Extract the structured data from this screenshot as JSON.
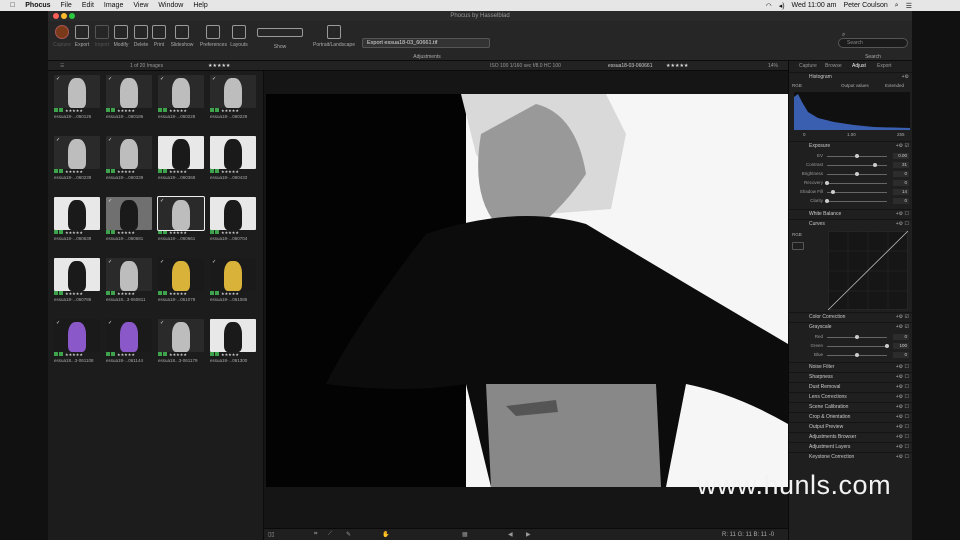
{
  "menubar": {
    "app_name": "Phocus",
    "items": [
      "File",
      "Edit",
      "Image",
      "View",
      "Window",
      "Help"
    ],
    "clock": "Wed 11:00 am",
    "user": "Peter Coulson"
  },
  "window_title": "Phocus by Hasselblad",
  "toolbar": {
    "buttons": [
      {
        "label": "Capture",
        "dim": true
      },
      {
        "label": "Export",
        "dim": false
      },
      {
        "label": "Import",
        "dim": true
      },
      {
        "label": "Modify",
        "dim": false
      },
      {
        "label": "Delete",
        "dim": false
      },
      {
        "label": "Print",
        "dim": false
      },
      {
        "label": "Slideshow",
        "dim": false
      },
      {
        "label": "Preferences",
        "dim": false
      },
      {
        "label": "Layouts",
        "dim": false
      }
    ],
    "show_label": "Show",
    "portrait_label": "Portrait/Landscape",
    "export_select": "Export essua18-03_60661.tif",
    "adjustments_label": "Adjustments",
    "search_placeholder": "Search",
    "search_label": "Search"
  },
  "infobar": {
    "image_count": "1 of 20 Images",
    "exif": "ISO 100   1/160 sec   f/8.0   HC 100",
    "filename": "essua18-03-060661",
    "zoom": "14%"
  },
  "thumbnails": [
    {
      "caption": "essua18-...060126",
      "tone": "dark"
    },
    {
      "caption": "essua18-...060186",
      "tone": "dark"
    },
    {
      "caption": "essua18-...060228",
      "tone": "dark"
    },
    {
      "caption": "essua18-...060229",
      "tone": "dark"
    },
    {
      "caption": "essua18-...060239",
      "tone": "dark"
    },
    {
      "caption": "essua18-...060339",
      "tone": "dark"
    },
    {
      "caption": "essua18-...060368",
      "tone": "light"
    },
    {
      "caption": "essua18-...060433",
      "tone": "light"
    },
    {
      "caption": "essua18-...060639",
      "tone": "light"
    },
    {
      "caption": "essua18-...060681",
      "tone": "grey"
    },
    {
      "caption": "essua18-...060661",
      "tone": "dark",
      "selected": true
    },
    {
      "caption": "essua18-...060704",
      "tone": "light"
    },
    {
      "caption": "essua18-...060786",
      "tone": "light"
    },
    {
      "caption": "essua18...3-060811",
      "tone": "dark"
    },
    {
      "caption": "essua18-...061078",
      "tone": "yellow"
    },
    {
      "caption": "essua18-...061085",
      "tone": "yellow"
    },
    {
      "caption": "essua18...3-061108",
      "tone": "purple"
    },
    {
      "caption": "essua18-...061144",
      "tone": "purple"
    },
    {
      "caption": "essua18...3-061179",
      "tone": "dark"
    },
    {
      "caption": "essua18-...061300",
      "tone": "light"
    }
  ],
  "thumb_stars": "★★★★★",
  "tools": {
    "tabs": [
      "Capture",
      "Browse",
      "Adjust",
      "Export"
    ],
    "active_tab": "Adjust",
    "histogram": {
      "title": "Histogram",
      "channel": "RGB",
      "output_values": "Output values",
      "extended": "Extended",
      "min": "0",
      "mid": "1.00",
      "max": "255"
    },
    "exposure": {
      "title": "Exposure",
      "sliders": [
        {
          "label": "EV",
          "value": "0.00"
        },
        {
          "label": "Contrast",
          "value": "31"
        },
        {
          "label": "Brightness",
          "value": "0"
        },
        {
          "label": "Recovery",
          "value": "0"
        },
        {
          "label": "Shadow Fill",
          "value": "14"
        },
        {
          "label": "Clarity",
          "value": "0"
        }
      ]
    },
    "white_balance": "White Balance",
    "curves": {
      "title": "Curves",
      "channel": "RGB"
    },
    "color_correction": "Color Correction",
    "grayscale": {
      "title": "Grayscale",
      "sliders": [
        {
          "label": "Red",
          "value": "0"
        },
        {
          "label": "Green",
          "value": "100"
        },
        {
          "label": "Blue",
          "value": "0"
        }
      ]
    },
    "panels": [
      "Noise Filter",
      "Sharpness",
      "Dust Removal",
      "Lens Corrections",
      "Scene Calibration",
      "Crop & Orientation",
      "Output Preview",
      "Adjustments Browser",
      "Adjustment Layers",
      "Keystone Correction"
    ]
  },
  "viewer": {
    "coords": "R:  11  G:  11  B:  11  -0"
  },
  "watermark": "www.hunls.com",
  "colors": {
    "accent": "#c0c0c0",
    "rating_green": "#3fa34d",
    "rating_red": "#c0392b"
  }
}
